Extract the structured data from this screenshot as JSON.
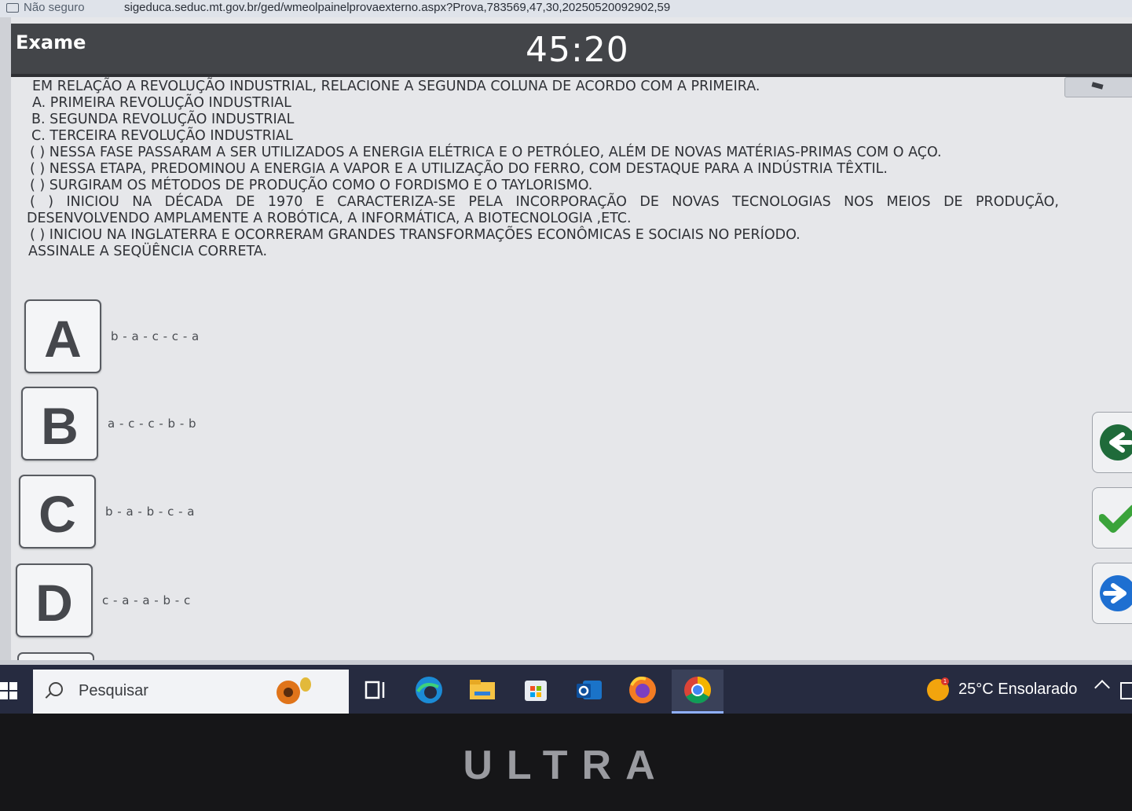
{
  "browser": {
    "security_label": "Não seguro",
    "url": "sigeduca.seduc.mt.gov.br/ged/wmeolpainelprovaexterno.aspx?Prova,783569,47,30,20250520092902,59"
  },
  "header": {
    "title": "Exame",
    "timer": "45:20"
  },
  "question": {
    "lines": [
      "EM RELAÇÃO A REVOLUÇÃO INDUSTRIAL, RELACIONE A SEGUNDA COLUNA DE ACORDO COM A PRIMEIRA.",
      "A. PRIMEIRA REVOLUÇÃO INDUSTRIAL",
      "B. SEGUNDA REVOLUÇÃO INDUSTRIAL",
      "C. TERCEIRA REVOLUÇÃO INDUSTRIAL",
      "( ) NESSA FASE PASSARAM A SER UTILIZADOS A ENERGIA ELÉTRICA E O PETRÓLEO, ALÉM DE NOVAS MATÉRIAS-PRIMAS COM O AÇO.",
      "( ) NESSA ETAPA, PREDOMINOU A ENERGIA A VAPOR E A UTILIZAÇÃO DO FERRO, COM DESTAQUE PARA A INDÚSTRIA TÊXTIL.",
      "( ) SURGIRAM OS MÉTODOS DE PRODUÇÃO COMO O FORDISMO E O TAYLORISMO.",
      "( ) INICIOU NA DÉCADA DE 1970 E CARACTERIZA-SE PELA INCORPORAÇÃO DE NOVAS TECNOLOGIAS NOS MEIOS DE PRODUÇÃO,",
      "DESENVOLVENDO AMPLAMENTE A ROBÓTICA, A INFORMÁTICA, A BIOTECNOLOGIA ,ETC.",
      "( ) INICIOU NA INGLATERRA E OCORRERAM GRANDES TRANSFORMAÇÕES ECONÔMICAS E SOCIAIS NO PERÍODO.",
      "ASSINALE A SEQÜÊNCIA CORRETA."
    ]
  },
  "options": [
    {
      "letter": "A",
      "text": "b - a - c - c - a"
    },
    {
      "letter": "B",
      "text": "a - c - c - b - b"
    },
    {
      "letter": "C",
      "text": "b - a - b - c - a"
    },
    {
      "letter": "D",
      "text": "c - a - a - b - c"
    }
  ],
  "nav_buttons": [
    {
      "name": "back",
      "icon": "arrow-left-icon",
      "color": "#1f6b3a"
    },
    {
      "name": "confirm",
      "icon": "checkmark-icon",
      "color": "#3aa33a"
    },
    {
      "name": "next",
      "icon": "arrow-right-icon",
      "color": "#1e6fd1"
    }
  ],
  "taskbar": {
    "search_placeholder": "Pesquisar",
    "apps": [
      "task-view-icon",
      "edge-icon",
      "file-explorer-icon",
      "store-icon",
      "outlook-icon",
      "firefox-icon",
      "chrome-icon"
    ],
    "weather": "25°C  Ensolarado",
    "weather_badge": "1"
  },
  "monitor": {
    "brand": "ULTRA"
  }
}
